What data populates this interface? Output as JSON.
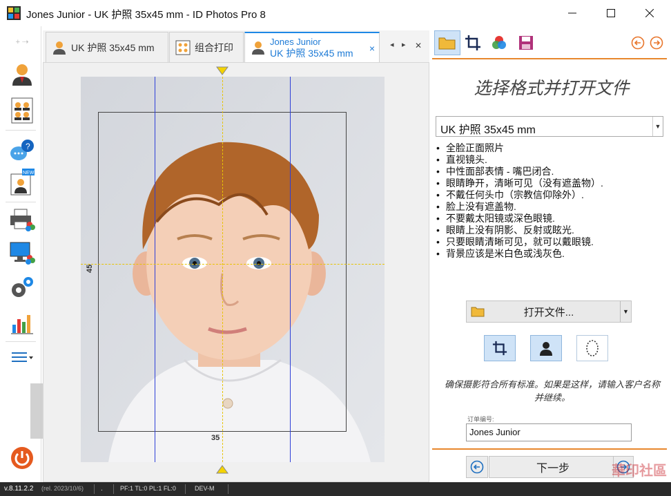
{
  "window": {
    "title": "Jones Junior - UK 护照 35x45 mm - ID Photos Pro 8",
    "controls": [
      "minimize",
      "maximize",
      "close"
    ]
  },
  "tabs": [
    {
      "label": "UK 护照 35x45 mm",
      "icon": "person-icon",
      "active": false
    },
    {
      "label": "组合打印",
      "icon": "group-print-icon",
      "active": false
    },
    {
      "label_line1": "Jones Junior",
      "label_line2": "UK 护照 35x45 mm",
      "icon": "person-icon",
      "active": true,
      "close": "×"
    }
  ],
  "tab_nav": {
    "prev": "◂",
    "next": "▸",
    "close": "✕"
  },
  "left_toolbar": [
    "person-icon",
    "group-print-icon",
    "help-chat-icon",
    "new-photo-icon",
    "printer-icon",
    "monitor-icon",
    "settings-gears-icon",
    "chart-icon",
    "menu-icon",
    "power-icon"
  ],
  "canvas": {
    "width_label": "35",
    "height_label": "45"
  },
  "right_panel": {
    "toolbar": [
      "folder-open-icon",
      "crop-icon",
      "color-icon",
      "save-icon"
    ],
    "nav": [
      "back-circle-icon",
      "forward-circle-icon"
    ],
    "heading": "选择格式并打开文件",
    "format_select": {
      "value": "UK 护照 35x45 mm"
    },
    "requirements": [
      "全脸正面照片",
      "直视镜头.",
      "中性面部表情 - 嘴巴闭合.",
      "眼睛睁开，清晰可见（没有遮盖物）.",
      "不戴任何头巾（宗教信仰除外）.",
      "脸上没有遮盖物.",
      "不要戴太阳镜或深色眼镜.",
      "眼睛上没有阴影、反射或眩光.",
      "只要眼睛清晰可见，就可以戴眼镜.",
      "背景应该是米白色或浅灰色."
    ],
    "open_button": "打开文件...",
    "modes": [
      "crop-mode-icon",
      "silhouette-mode-icon",
      "oval-mode-icon"
    ],
    "note": "确保摄影符合所有标准。如果是这样，请输入客户名称并继续。",
    "order_label": "订单编号:",
    "order_value": "Jones Junior",
    "next_button": "下一步"
  },
  "status_bar": {
    "version": "v.8.11.2.2",
    "release": "(rel. 2023/10/6)",
    "dot": ".",
    "flags": "PF:1 TL:0 PL:1 FL:0",
    "mode": "DEV-M"
  },
  "watermark": "華印社區"
}
